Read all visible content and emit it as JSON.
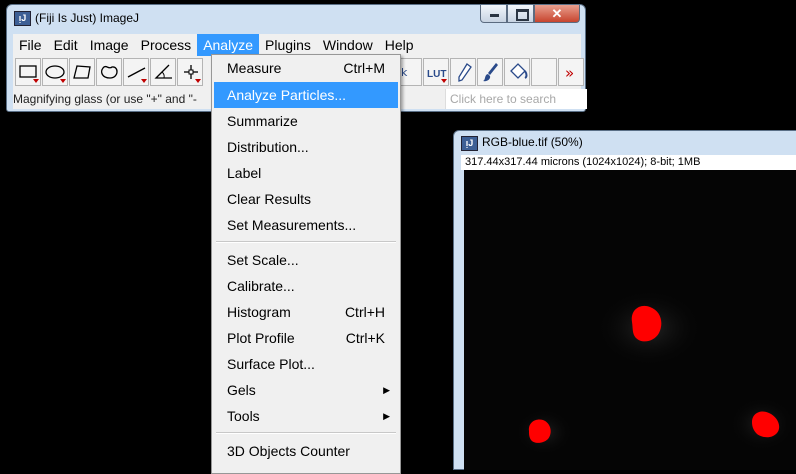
{
  "main_window": {
    "title": "(Fiji Is Just) ImageJ",
    "icon_text": "ᴉJ",
    "close_glyph": "✕"
  },
  "menubar": {
    "items": [
      "File",
      "Edit",
      "Image",
      "Process",
      "Analyze",
      "Plugins",
      "Window",
      "Help"
    ],
    "active": "Analyze"
  },
  "toolbar": {
    "tools": [
      "rectangle-selection-icon",
      "oval-selection-icon",
      "polygon-selection-icon",
      "freehand-selection-icon",
      "line-selection-icon",
      "angle-tool-icon",
      "point-tool-icon"
    ],
    "right_tools": [
      "dropper-icon",
      "lut-icon",
      "pencil-icon",
      "brush-icon",
      "flood-fill-icon",
      "more-tools-icon"
    ],
    "lut_label": "LUT",
    "more_label": "»"
  },
  "status": {
    "text": "Magnifying glass (or use \"+\" and \"-",
    "search_placeholder": "Click here to search"
  },
  "analyze_menu": {
    "items": [
      {
        "label": "Measure",
        "shortcut": "Ctrl+M"
      },
      {
        "label": "Analyze Particles...",
        "shortcut": "",
        "highlighted": true
      },
      {
        "label": "Summarize",
        "shortcut": ""
      },
      {
        "label": "Distribution...",
        "shortcut": ""
      },
      {
        "label": "Label",
        "shortcut": ""
      },
      {
        "label": "Clear Results",
        "shortcut": ""
      },
      {
        "label": "Set Measurements...",
        "shortcut": ""
      },
      {
        "label": "Set Scale...",
        "shortcut": ""
      },
      {
        "label": "Calibrate...",
        "shortcut": ""
      },
      {
        "label": "Histogram",
        "shortcut": "Ctrl+H"
      },
      {
        "label": "Plot Profile",
        "shortcut": "Ctrl+K"
      },
      {
        "label": "Surface Plot...",
        "shortcut": ""
      },
      {
        "label": "Gels",
        "submenu": true
      },
      {
        "label": "Tools",
        "submenu": true
      },
      {
        "label": "3D Objects Counter",
        "shortcut": ""
      }
    ]
  },
  "image_window": {
    "title": "RGB-blue.tif (50%)",
    "info": "317.44x317.44 microns (1024x1024); 8-bit; 1MB",
    "particle_color": "#ff0000",
    "background_color": "#050505"
  }
}
